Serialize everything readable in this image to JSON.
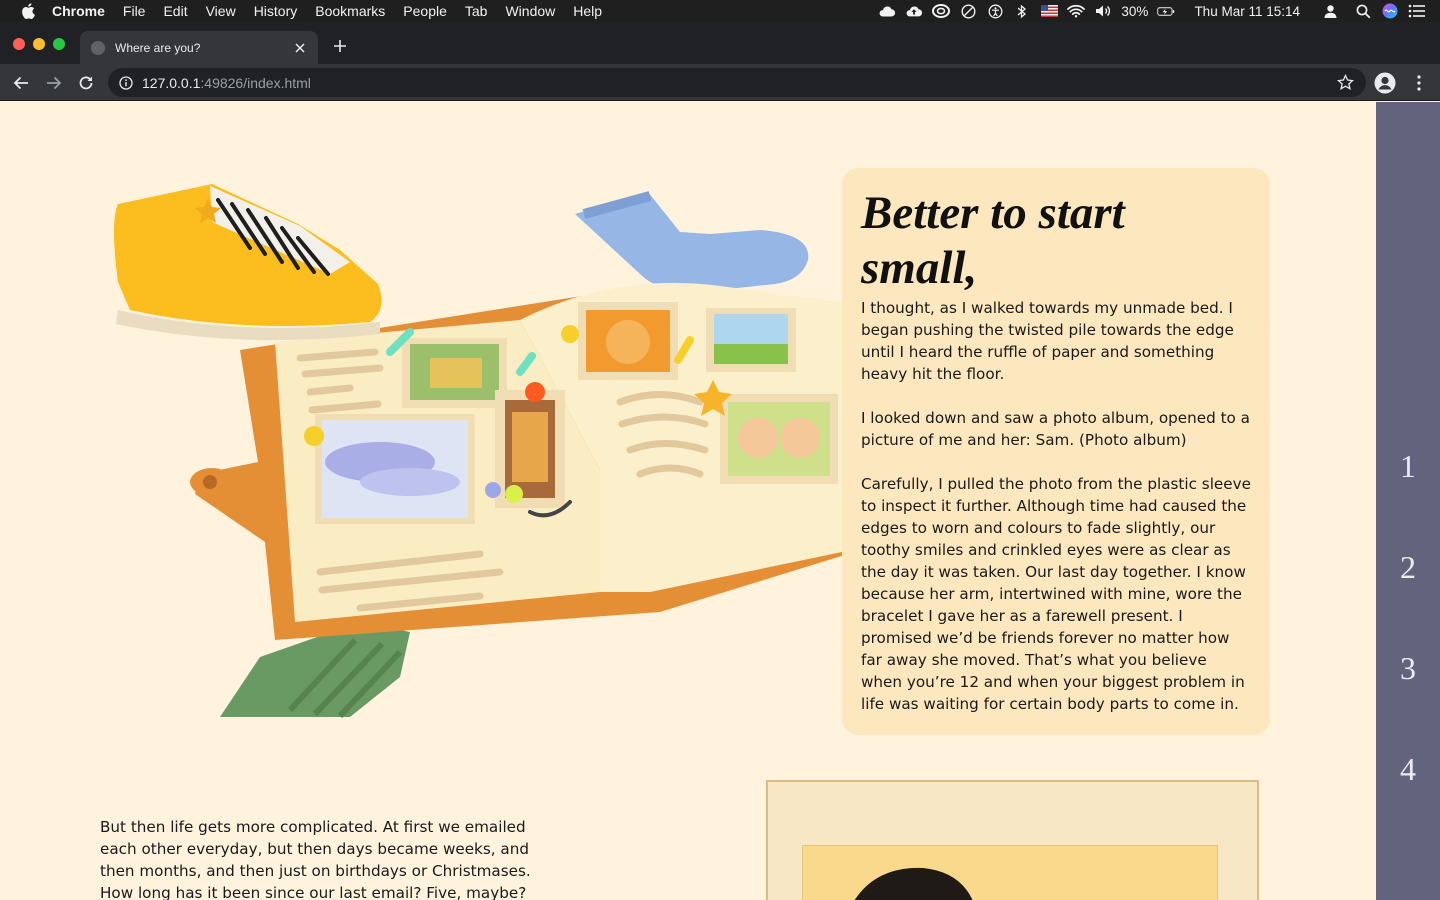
{
  "menubar": {
    "app_name": "Chrome",
    "items": [
      "File",
      "Edit",
      "View",
      "History",
      "Bookmarks",
      "People",
      "Tab",
      "Window",
      "Help"
    ],
    "battery": "30%",
    "clock": "Thu Mar 11  15:14"
  },
  "browser": {
    "tab_title": "Where are you?",
    "url_host": "127.0.0.1",
    "url_path": ":49826/index.html"
  },
  "story": {
    "title": "Better to start small,",
    "paragraphs": [
      "I thought, as I walked towards my unmade bed. I began pushing the twisted pile towards the edge until I heard the ruffle of paper and something heavy hit the floor.",
      "I looked down and saw a photo album, opened to a picture of me and her: Sam. (Photo album)",
      "Carefully, I pulled the photo from the plastic sleeve to inspect it further. Although time had caused the edges to worn and colours to fade slightly, our toothy smiles and crinkled eyes were as clear as the day it was taken. Our last day together. I know because her arm, intertwined with mine, wore the bracelet I gave her as a farewell present. I promised we’d be friends forever no matter how far away she moved. That’s what you believe when you’re 12 and when your biggest problem in life was waiting for certain body parts to come in."
    ],
    "lower_paragraph": "But then life gets more complicated. At first we emailed each other everyday, but then days became weeks, and then months, and then just on birthdays or Christmases. How long has it been since our last email? Five, maybe?"
  },
  "chapters": [
    "1",
    "2",
    "3",
    "4"
  ],
  "colors": {
    "page_bg": "#fff3de",
    "card_bg": "#fde7bf",
    "rail_bg": "#63637e"
  }
}
